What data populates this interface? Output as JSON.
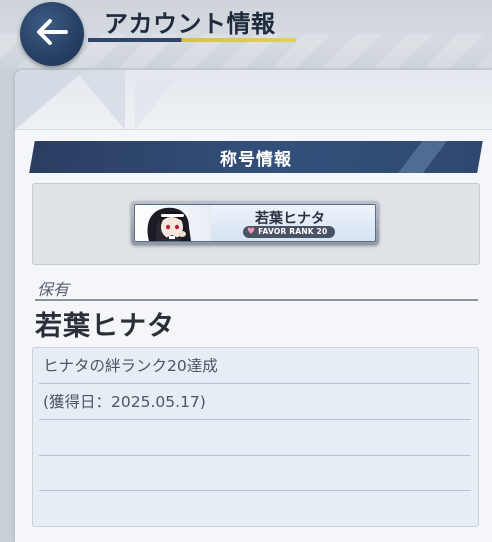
{
  "header": {
    "title": "アカウント情報",
    "back_icon": "arrow-left-icon"
  },
  "section": {
    "title": "称号情報"
  },
  "title_plate": {
    "name": "若葉ヒナタ",
    "badge_icon": "heart-icon",
    "badge_text": "FAVOR RANK 20"
  },
  "owned": {
    "label": "保有",
    "title_name": "若葉ヒナタ"
  },
  "description": {
    "condition": "ヒナタの絆ランク20達成",
    "acquired": "(獲得日：2025.05.17)"
  },
  "colors": {
    "banner": "#2f4870",
    "accent_underline": "#d8c24a",
    "panel": "#f5f6f9"
  }
}
